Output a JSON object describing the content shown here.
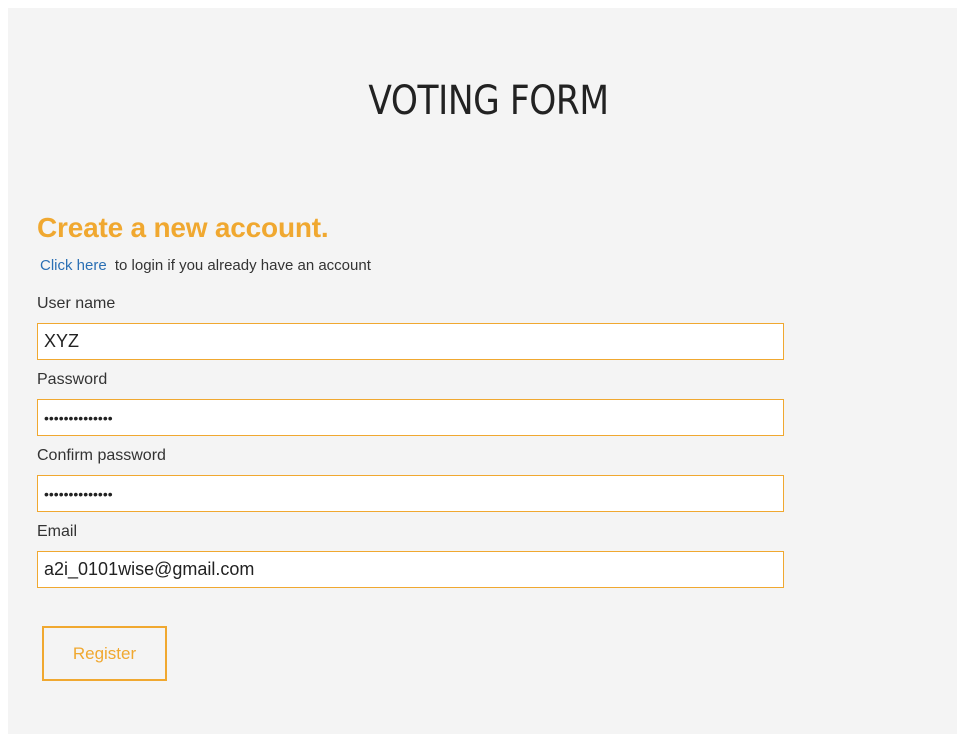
{
  "form": {
    "title": "VOTING FORM",
    "subtitle": "Create a new account.",
    "login_link": "Click here",
    "login_text": "to login if you already have an account",
    "fields": [
      {
        "label": "User name",
        "value": "XYZ"
      },
      {
        "label": "Password",
        "value": "••••••••••••••"
      },
      {
        "label": "Confirm password",
        "value": "••••••••••••••"
      },
      {
        "label": "Email",
        "value": "a2i_0101wise@gmail.com"
      }
    ],
    "register_label": "Register"
  },
  "colors": {
    "accent": "#f0a830",
    "link": "#2a6fb4",
    "panel_background": "#f4f4f4"
  }
}
